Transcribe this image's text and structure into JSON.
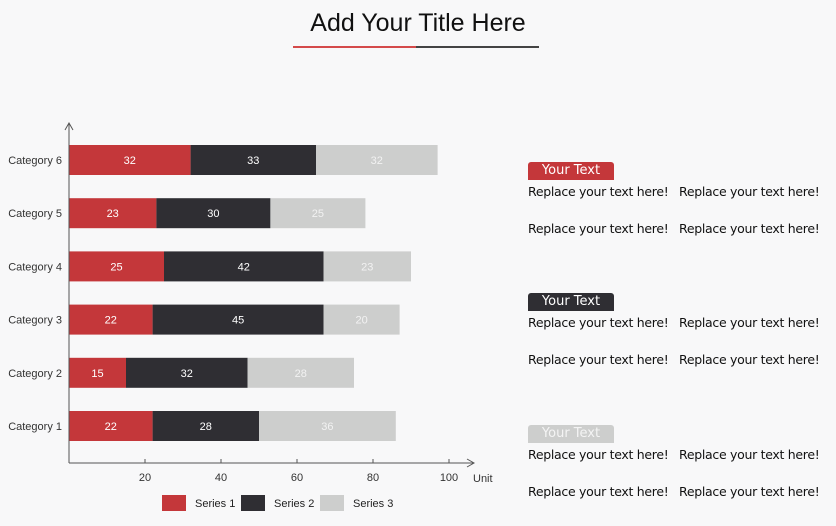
{
  "title": "Add Your Title Here",
  "colors": {
    "series1": "#c4373a",
    "series2": "#2f2e33",
    "series3": "#cdcecd",
    "title_underline_left": "#d44a4a",
    "title_underline_right": "#444444"
  },
  "chart_data": {
    "type": "bar",
    "orientation": "horizontal",
    "stacked": true,
    "title": "Add Your Title Here",
    "categories": [
      "Category 1",
      "Category 2",
      "Category 3",
      "Category 4",
      "Category 5",
      "Category 6"
    ],
    "series": [
      {
        "name": "Series 1",
        "values": [
          22,
          15,
          22,
          25,
          23,
          32
        ]
      },
      {
        "name": "Series 2",
        "values": [
          28,
          32,
          45,
          42,
          30,
          33
        ]
      },
      {
        "name": "Series 3",
        "values": [
          36,
          28,
          20,
          23,
          25,
          32
        ]
      }
    ],
    "xlabel": "Unit",
    "ylabel": "",
    "xlim": [
      0,
      100
    ],
    "xticks": [
      20,
      40,
      60,
      80,
      100
    ],
    "grid": false,
    "legend": "bottom"
  },
  "panels": [
    {
      "badge": "Your Text",
      "badge_color": "#c4373a",
      "badge_text_color": "#ffffff",
      "lines": [
        [
          "Replace your text here!",
          "Replace your text here!"
        ],
        [
          "Replace your text here!",
          "Replace your text here!"
        ]
      ]
    },
    {
      "badge": "Your Text",
      "badge_color": "#2f2e33",
      "badge_text_color": "#ffffff",
      "lines": [
        [
          "Replace your text here!",
          "Replace your text here!"
        ],
        [
          "Replace your text here!",
          "Replace your text here!"
        ]
      ]
    },
    {
      "badge": "Your Text",
      "badge_color": "#cdcecd",
      "badge_text_color": "#f4f4f4",
      "lines": [
        [
          "Replace your text here!",
          "Replace your text here!"
        ],
        [
          "Replace your text here!",
          "Replace your text here!"
        ]
      ]
    }
  ]
}
